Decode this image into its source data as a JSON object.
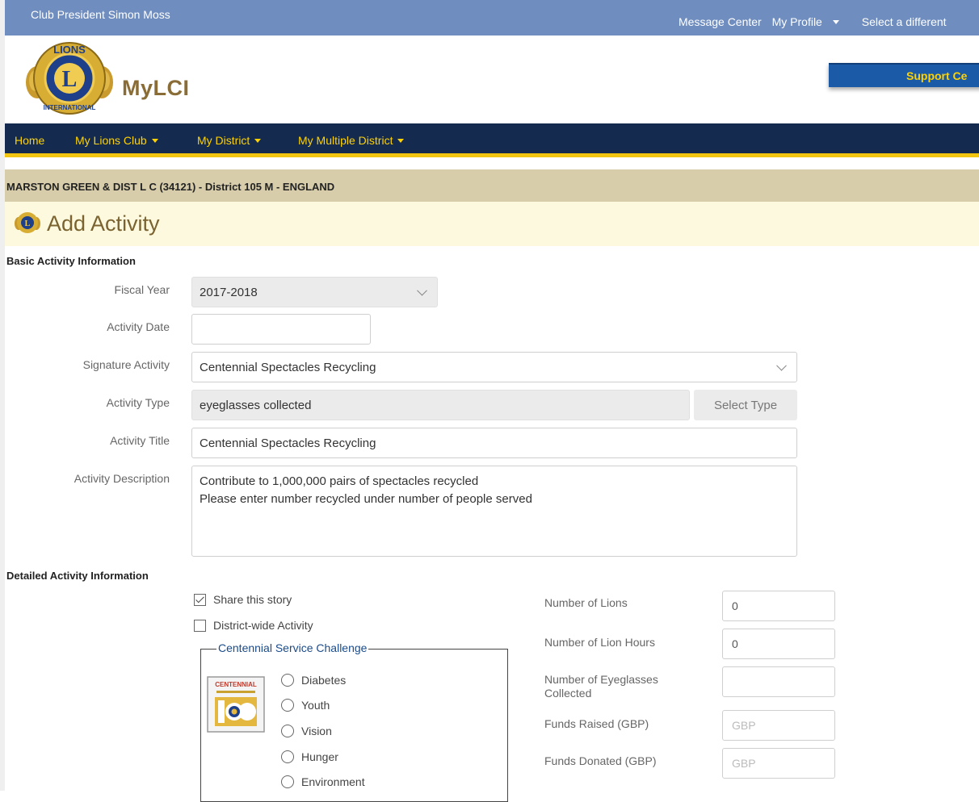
{
  "topbar": {
    "user": "Club President Simon Moss",
    "links": {
      "message_center": "Message Center",
      "my_profile": "My Profile",
      "select_different": "Select a different"
    }
  },
  "brand": {
    "name": "MyLCI",
    "logo_icon": "lions-international-logo"
  },
  "support_button": "Support Ce",
  "nav": {
    "home": "Home",
    "my_lions_club": "My Lions Club",
    "my_district": "My District",
    "my_multiple_district": "My Multiple District"
  },
  "club": {
    "banner": "MARSTON GREEN & DIST L C (34121) - District 105 M - ENGLAND"
  },
  "page": {
    "title": "Add Activity"
  },
  "basic": {
    "title": "Basic Activity Information",
    "fiscal_year": {
      "label": "Fiscal Year",
      "value": "2017-2018"
    },
    "activity_date": {
      "label": "Activity Date",
      "value": ""
    },
    "signature_activity": {
      "label": "Signature Activity",
      "value": "Centennial Spectacles Recycling"
    },
    "activity_type": {
      "label": "Activity Type",
      "value": "eyeglasses collected",
      "button": "Select Type"
    },
    "activity_title": {
      "label": "Activity Title",
      "value": "Centennial Spectacles Recycling"
    },
    "activity_description": {
      "label": "Activity Description",
      "line1": "Contribute to 1,000,000 pairs of spectacles recycled",
      "line2": "Please enter number recycled under number of people served"
    }
  },
  "detailed": {
    "title": "Detailed Activity Information",
    "share_story": {
      "label": "Share this story",
      "checked": true
    },
    "district_wide": {
      "label": "District-wide Activity",
      "checked": false
    },
    "challenge": {
      "legend": "Centennial Service Challenge",
      "image_text": "CENTENNIAL",
      "options": [
        "Diabetes",
        "Youth",
        "Vision",
        "Hunger",
        "Environment"
      ]
    },
    "fields": {
      "num_lions": {
        "label": "Number of Lions",
        "value": "0"
      },
      "lion_hours": {
        "label": "Number of Lion Hours",
        "value": "0"
      },
      "eyeglasses_line1": "Number of Eyeglasses",
      "eyeglasses_line2": "Collected",
      "eyeglasses_value": "",
      "funds_raised": {
        "label": "Funds Raised (GBP)",
        "placeholder": "GBP"
      },
      "funds_donated": {
        "label": "Funds Donated (GBP)",
        "placeholder": "GBP"
      }
    }
  },
  "colors": {
    "topbar": "#6f8dbf",
    "nav": "#142a4e",
    "nav_text": "#ffd200",
    "club_bar": "#d7cdab",
    "title_bar": "#fdf9de",
    "accent_gold": "#f2c511"
  }
}
